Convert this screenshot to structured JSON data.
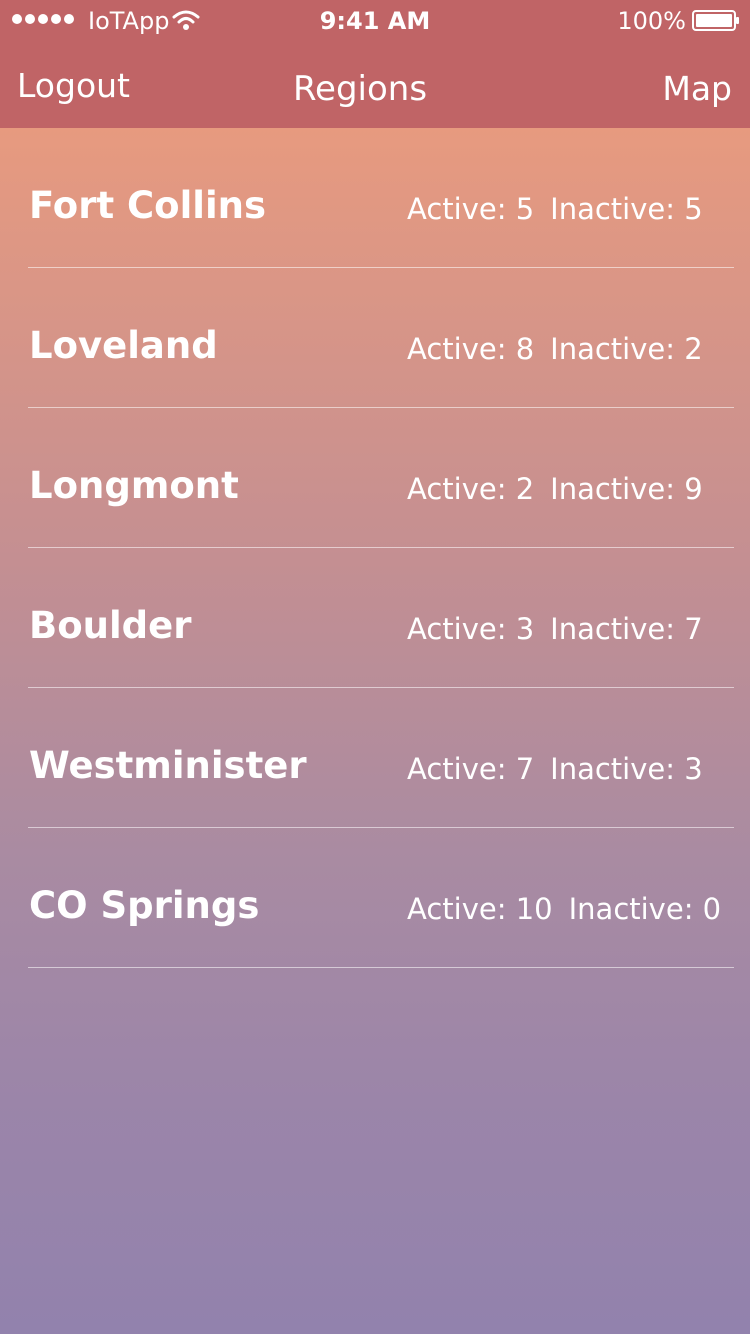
{
  "status_bar": {
    "carrier": "IoTApp",
    "time": "9:41 AM",
    "battery": "100%"
  },
  "nav": {
    "left_label": "Logout",
    "title": "Regions",
    "right_label": "Map"
  },
  "regions": [
    {
      "name": "Fort Collins",
      "active": "Active: 5",
      "inactive": "Inactive: 5"
    },
    {
      "name": "Loveland",
      "active": "Active: 8",
      "inactive": "Inactive: 2"
    },
    {
      "name": "Longmont",
      "active": "Active: 2",
      "inactive": "Inactive: 9"
    },
    {
      "name": "Boulder",
      "active": "Active: 3",
      "inactive": "Inactive: 7"
    },
    {
      "name": "Westminister",
      "active": "Active: 7",
      "inactive": "Inactive: 3"
    },
    {
      "name": "CO Springs",
      "active": "Active: 10",
      "inactive": "Inactive: 0"
    }
  ],
  "colors": {
    "header": "#c06466",
    "gradient_top": "#e79a7f",
    "gradient_bottom": "#9282ad"
  },
  "icons": [
    "signal-icon",
    "wifi-icon",
    "battery-icon"
  ]
}
